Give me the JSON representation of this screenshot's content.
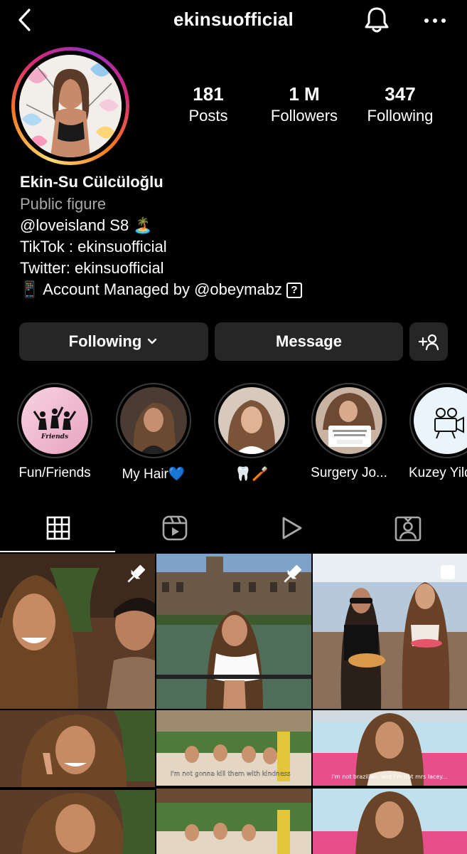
{
  "header": {
    "username": "ekinsuofficial"
  },
  "stats": [
    {
      "value": "181",
      "label": "Posts"
    },
    {
      "value": "1 M",
      "label": "Followers"
    },
    {
      "value": "347",
      "label": "Following"
    }
  ],
  "bio": {
    "name": "Ekin-Su Cülcüloğlu",
    "category": "Public figure",
    "line1": "@loveisland S8 🏝️",
    "line2": "TikTok : ekinsuofficial",
    "line3": "Twitter: ekinsuofficial",
    "line4": "📱 Account Managed by @obeymabz",
    "line4_badge": "?"
  },
  "actions": {
    "following_label": "Following",
    "message_label": "Message"
  },
  "highlights": [
    {
      "label": "Fun/Friends",
      "cover_text": "Friends"
    },
    {
      "label": "My Hair💙"
    },
    {
      "label": "🦷🪥"
    },
    {
      "label": "Surgery Jo..."
    },
    {
      "label": "Kuzey Yild"
    }
  ],
  "posts": [
    {
      "pinned": true
    },
    {
      "pinned": true
    },
    {
      "multi": true
    },
    {},
    {
      "caption": "I'm not gonna kill them with kindness"
    },
    {
      "caption": "i'm not brazilian, and i'm not mrs lacey..."
    }
  ]
}
